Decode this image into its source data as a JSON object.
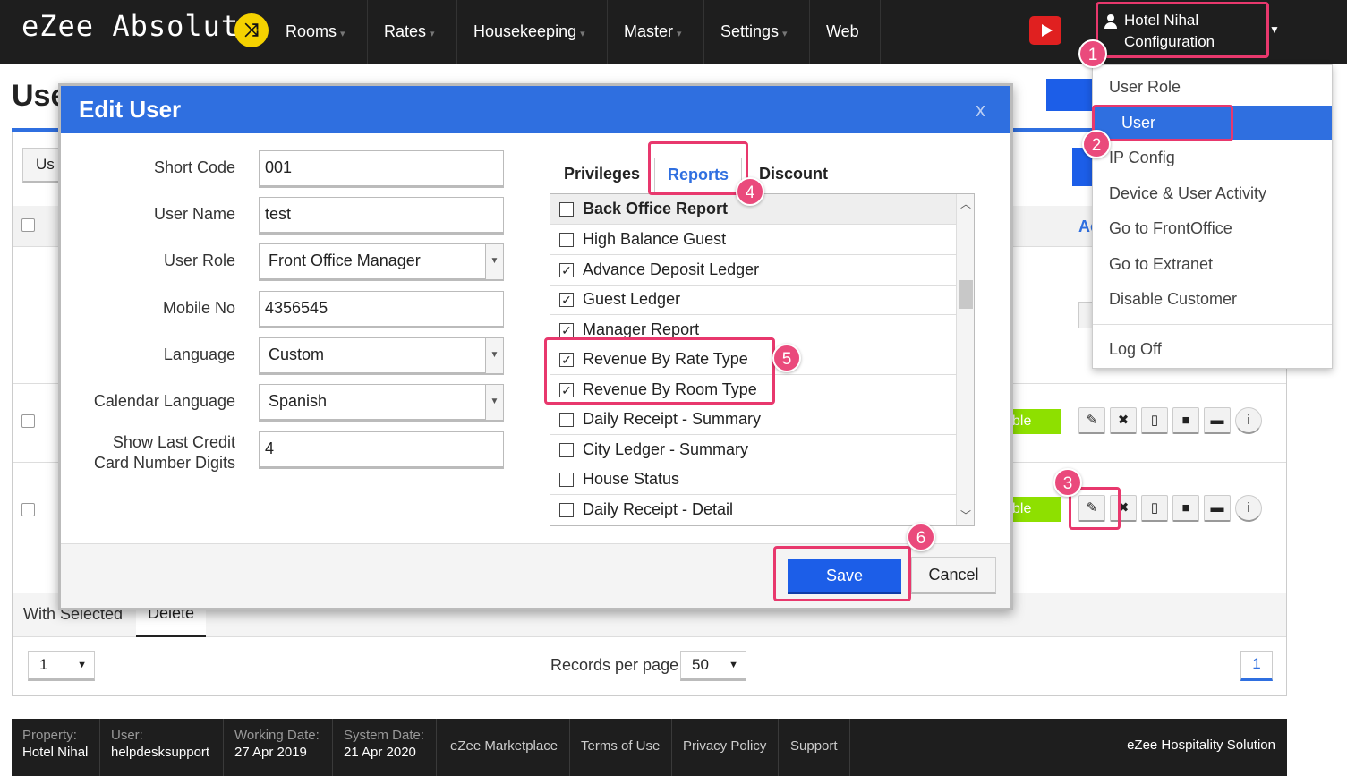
{
  "app": {
    "logo": "eZee Absolute"
  },
  "nav": {
    "items": [
      "Rooms",
      "Rates",
      "Housekeeping",
      "Master",
      "Settings",
      "Web"
    ]
  },
  "user_menu": {
    "line1": "Hotel Nihal",
    "line2": "Configuration"
  },
  "dropdown": {
    "items": [
      "User Role",
      "User",
      "IP Config",
      "Device & User Activity",
      "Go to FrontOffice",
      "Go to Extranet",
      "Disable Customer",
      "Log Off"
    ],
    "selected": "User"
  },
  "background": {
    "page_title": "Users",
    "tab_fragment": "Us",
    "column_fragment": "Ac",
    "status_fragment": "ble",
    "with_selected": "With Selected",
    "delete_label": "Delete",
    "page_select": "1",
    "records_per_page_label": "Records per page",
    "records_per_page_value": "50",
    "pager_current": "1"
  },
  "modal": {
    "title": "Edit User",
    "close": "x",
    "fields": {
      "short_code": {
        "label": "Short Code",
        "value": "001"
      },
      "user_name": {
        "label": "User Name",
        "value": "test"
      },
      "user_role": {
        "label": "User Role",
        "value": "Front Office Manager"
      },
      "mobile_no": {
        "label": "Mobile No",
        "value": "4356545"
      },
      "language": {
        "label": "Language",
        "value": "Custom"
      },
      "calendar_language": {
        "label": "Calendar Language",
        "value": "Spanish"
      },
      "show_last_credit": {
        "label_line1": "Show Last Credit",
        "label_line2": "Card Number Digits",
        "value": "4"
      }
    },
    "tabs": [
      "Privileges",
      "Reports",
      "Discount"
    ],
    "active_tab": "Reports",
    "reports": [
      {
        "label": "Back Office Report",
        "checked": false,
        "header": true
      },
      {
        "label": "High Balance Guest",
        "checked": false
      },
      {
        "label": "Advance Deposit Ledger",
        "checked": true
      },
      {
        "label": "Guest Ledger",
        "checked": true
      },
      {
        "label": "Manager Report",
        "checked": true
      },
      {
        "label": "Revenue By Rate Type",
        "checked": true
      },
      {
        "label": "Revenue By Room Type",
        "checked": true
      },
      {
        "label": "Daily Receipt - Summary",
        "checked": false
      },
      {
        "label": "City Ledger - Summary",
        "checked": false
      },
      {
        "label": "House Status",
        "checked": false
      },
      {
        "label": "Daily Receipt - Detail",
        "checked": false
      }
    ],
    "save_label": "Save",
    "cancel_label": "Cancel"
  },
  "footer": {
    "property_label": "Property:",
    "property_value": "Hotel Nihal",
    "user_label": "User:",
    "user_value": "helpdesksupport",
    "working_label": "Working Date:",
    "working_value": "27 Apr 2019",
    "system_label": "System Date:",
    "system_value": "21 Apr 2020",
    "links": [
      "eZee Marketplace",
      "Terms of Use",
      "Privacy Policy",
      "Support"
    ],
    "brand": "eZee Hospitality Solution"
  },
  "annotations": [
    "1",
    "2",
    "3",
    "4",
    "5",
    "6"
  ],
  "colors": {
    "accent": "#2f6fe0",
    "annotation": "#e8386d",
    "topbar": "#1e1e1e",
    "status_green": "#8ee000"
  }
}
